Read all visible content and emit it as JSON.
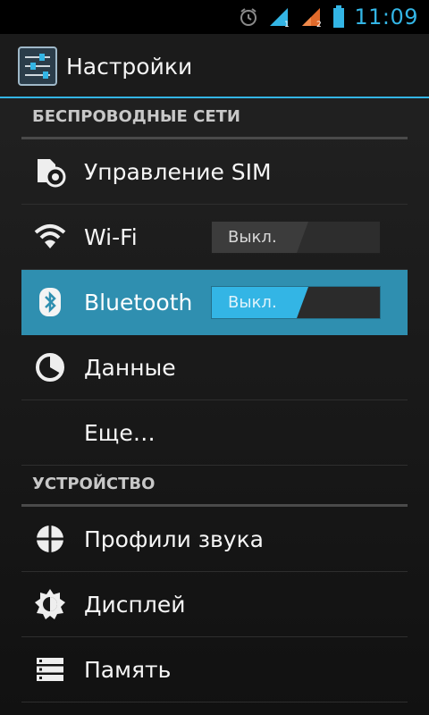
{
  "status_bar": {
    "time": "11:09",
    "icons": [
      "alarm-icon",
      "signal-sim1-icon",
      "signal-sim2-icon",
      "battery-icon"
    ],
    "accent": "#33b5e5"
  },
  "action_bar": {
    "title": "Настройки",
    "icon": "settings-sliders-icon"
  },
  "sections": [
    {
      "header": "БЕСПРОВОДНЫЕ СЕТИ",
      "items": [
        {
          "label": "Управление SIM",
          "icon": "sim-manage-icon"
        },
        {
          "label": "Wi-Fi",
          "icon": "wifi-icon",
          "toggle": "Выкл."
        },
        {
          "label": "Bluetooth",
          "icon": "bluetooth-icon",
          "toggle": "Выкл.",
          "selected": true
        },
        {
          "label": "Данные",
          "icon": "data-usage-icon"
        },
        {
          "label": "Еще…",
          "icon": ""
        }
      ]
    },
    {
      "header": "УСТРОЙСТВО",
      "items": [
        {
          "label": "Профили звука",
          "icon": "sound-profile-icon"
        },
        {
          "label": "Дисплей",
          "icon": "display-icon"
        },
        {
          "label": "Память",
          "icon": "storage-icon"
        }
      ]
    }
  ],
  "colors": {
    "accent": "#33b5e5",
    "selected_row": "#2f8fb0"
  }
}
